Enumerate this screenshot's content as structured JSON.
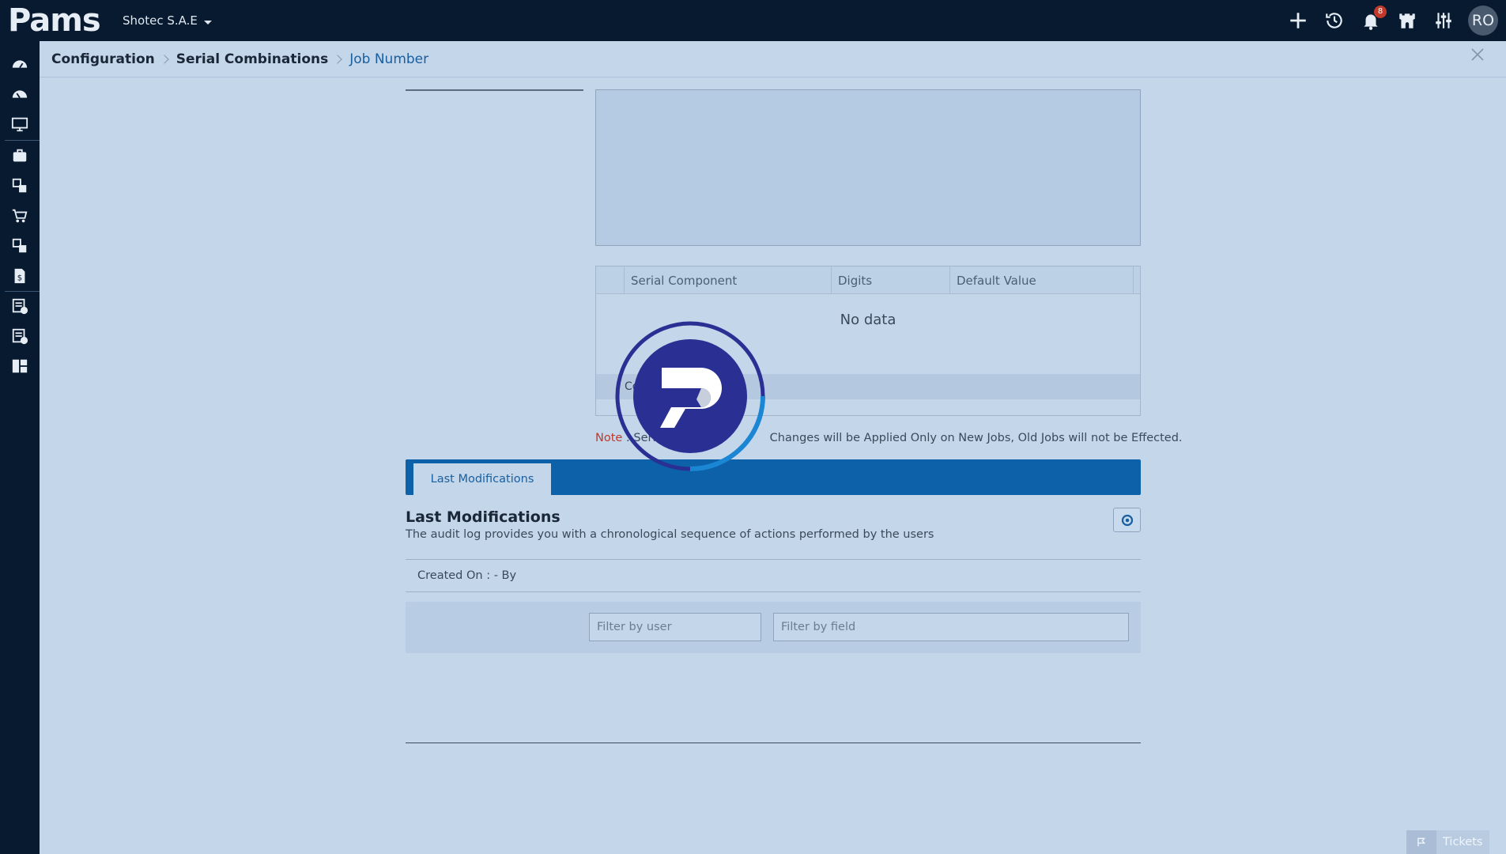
{
  "app": {
    "logo_text": "Pams",
    "company": "Shotec S.A.E",
    "user_initials": "RO",
    "notification_count": "8",
    "icons": [
      "plus-icon",
      "history-icon",
      "bell-icon",
      "castle-icon",
      "sliders-icon"
    ]
  },
  "sidebar": {
    "icons": [
      "dashboard-icon",
      "dashboard-alt-icon",
      "monitor-icon",
      "briefcase-icon",
      "modules-icon",
      "cart-icon",
      "modules-alt-icon",
      "invoice-dollar-icon",
      "report-check-icon",
      "report-settings-icon",
      "layout-icon"
    ]
  },
  "breadcrumb": {
    "items": [
      "Configuration",
      "Serial Combinations"
    ],
    "active": "Job Number"
  },
  "grid": {
    "columns": [
      "Serial Component",
      "Digits",
      "Default Value"
    ],
    "empty_text": "No data",
    "footer_text": "Co"
  },
  "note": {
    "label": "Note",
    "text": " : Serial ",
    "text2": " Changes will be Applied Only on New Jobs, Old Jobs will not be Effected."
  },
  "tabs": {
    "active": "Last Modifications"
  },
  "last_modifications": {
    "title": "Last Modifications",
    "description": "The audit log provides you with a chronological sequence of actions performed by the users",
    "created_on": "Created On : - By",
    "filter_user_placeholder": "Filter by user",
    "filter_field_placeholder": "Filter by field"
  },
  "footer": {
    "tickets_label": "Tickets"
  },
  "colors": {
    "topbar": "#081a30",
    "accent": "#0d61a8",
    "background": "#c3d6ea",
    "loader": "#2a2f94",
    "note_red": "#c0392b"
  }
}
